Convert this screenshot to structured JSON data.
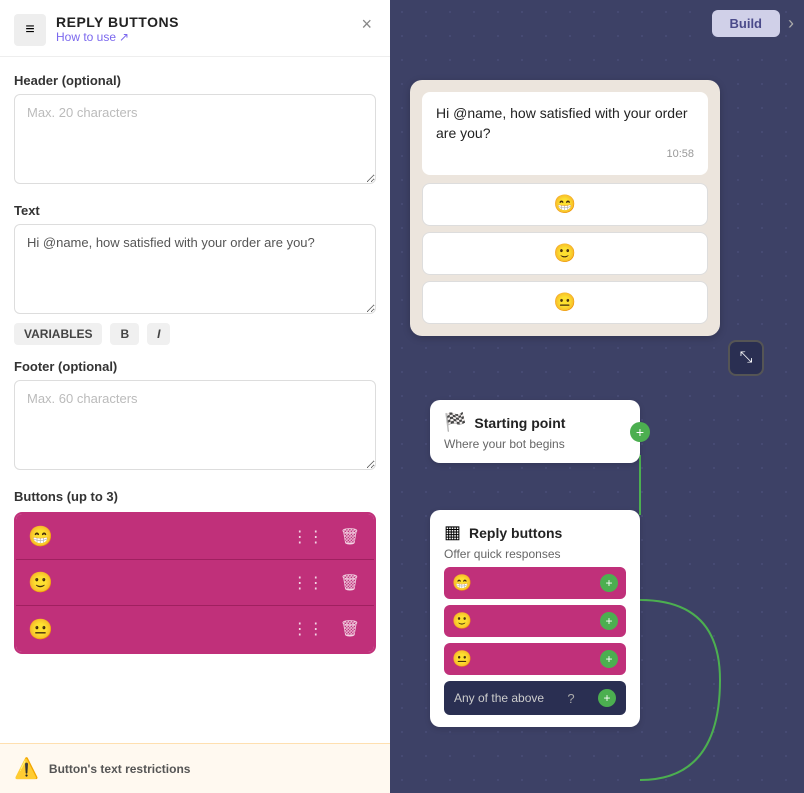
{
  "panel": {
    "title": "REPLY BUTTONS",
    "link": "How to use",
    "close_label": "×",
    "icon": "≡"
  },
  "header_field": {
    "label": "Header (optional)",
    "placeholder": "Max. 20 characters",
    "value": ""
  },
  "text_field": {
    "label": "Text",
    "value": "Hi @name, how satisfied with your order are you?"
  },
  "toolbar": {
    "variables": "VARIABLES",
    "bold": "B",
    "italic": "I"
  },
  "footer_field": {
    "label": "Footer (optional)",
    "placeholder": "Max. 60 characters",
    "value": ""
  },
  "buttons_section": {
    "label": "Buttons (up to 3)",
    "buttons": [
      {
        "emoji": "😁",
        "id": "btn1"
      },
      {
        "emoji": "🙂",
        "id": "btn2"
      },
      {
        "emoji": "😐",
        "id": "btn3"
      }
    ]
  },
  "warning": {
    "text": "Button's text restrictions"
  },
  "topbar": {
    "build": "Build"
  },
  "chat_preview": {
    "message": "Hi @name, how satisfied with your order are you?",
    "time": "10:58",
    "buttons": [
      "😁",
      "🙂",
      "😐"
    ]
  },
  "flow": {
    "starting_node": {
      "title": "Starting point",
      "subtitle": "Where your bot begins",
      "icon": "🏁"
    },
    "reply_node": {
      "title": "Reply buttons",
      "subtitle": "Offer quick responses",
      "icon": "▦",
      "buttons": [
        "😁",
        "🙂",
        "😐"
      ],
      "any_above": "Any of the above"
    }
  },
  "icons": {
    "drag": "⋮⋮",
    "delete": "🗑",
    "external_link": "↗",
    "collapse": "⤡",
    "warning": "⚠",
    "chevron_right": "›",
    "help": "?"
  }
}
